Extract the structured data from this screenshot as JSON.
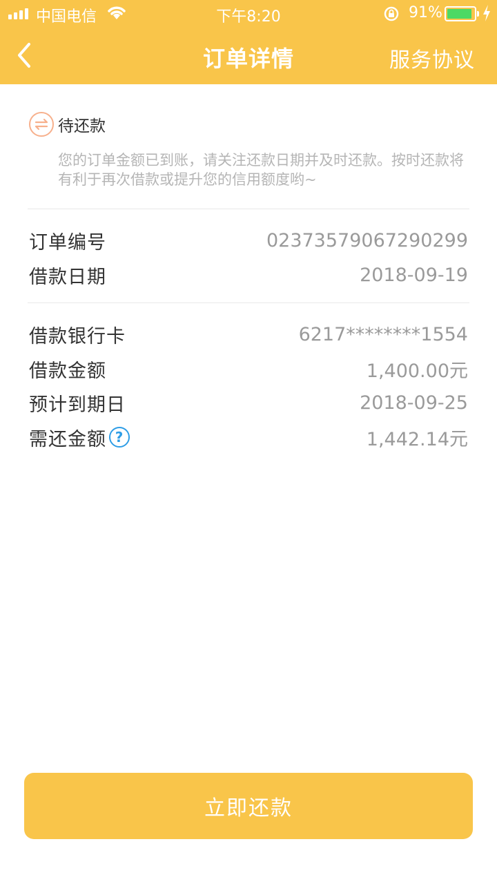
{
  "status_bar": {
    "carrier": "中国电信",
    "time": "下午8:20",
    "battery_percent": "91%",
    "battery_level": 0.91
  },
  "nav": {
    "title": "订单详情",
    "right_link": "服务协议"
  },
  "order_status": {
    "label": "待还款",
    "description": "您的订单金额已到账，请关注还款日期并及时还款。按时还款将有利于再次借款或提升您的信用额度哟~"
  },
  "order_info": [
    {
      "label": "订单编号",
      "value": "02373579067290299"
    },
    {
      "label": "借款日期",
      "value": "2018-09-19"
    }
  ],
  "loan_info": [
    {
      "label": "借款银行卡",
      "value": "6217********1554"
    },
    {
      "label": "借款金额",
      "value": "1,400.00元"
    },
    {
      "label": "预计到期日",
      "value": "2018-09-25"
    },
    {
      "label": "需还金额",
      "value": "1,442.14元"
    }
  ],
  "help_icon_glyph": "?",
  "repay_button": {
    "label": "立即还款"
  },
  "colors": {
    "brand": "#f9c54a",
    "status_icon": "#f7b08c",
    "help_icon": "#2e9de6"
  }
}
